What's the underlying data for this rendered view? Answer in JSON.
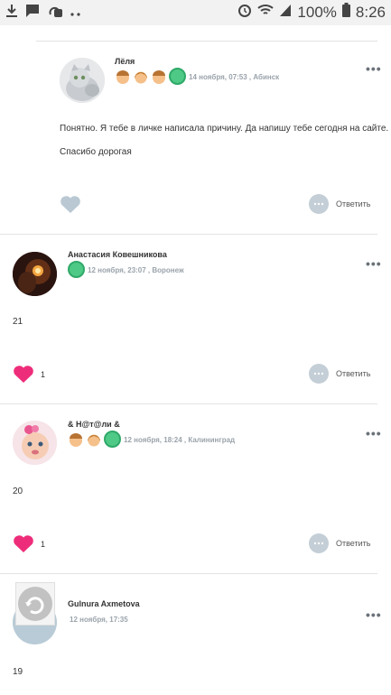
{
  "status_bar": {
    "battery": "100%",
    "time": "8:26"
  },
  "comments": [
    {
      "author": "Лёля",
      "meta": "14 ноября, 07:53 , Абинск",
      "body": [
        "Понятно. Я тебе в личке написала причину. Да напишу тебе сегодня на сайте.",
        "Спасибо дорогая"
      ],
      "likes": "",
      "reply_label": "Ответить"
    },
    {
      "author": "Анастасия Ковешникова",
      "meta": "12 ноября, 23:07 , Воронеж",
      "body": [
        "21"
      ],
      "likes": "1",
      "reply_label": "Ответить"
    },
    {
      "author": "& Н@т@ли &",
      "meta": "12 ноября, 18:24 , Калининград",
      "body": [
        "20"
      ],
      "likes": "1",
      "reply_label": "Ответить"
    },
    {
      "author": "Gulnura Axmetova",
      "meta": "12 ноября, 17:35",
      "body": [
        "19"
      ]
    }
  ],
  "colors": {
    "heart_active": "#ee2d7a",
    "heart_inactive": "#b9c8d3",
    "badge_green": "#4fc986"
  }
}
